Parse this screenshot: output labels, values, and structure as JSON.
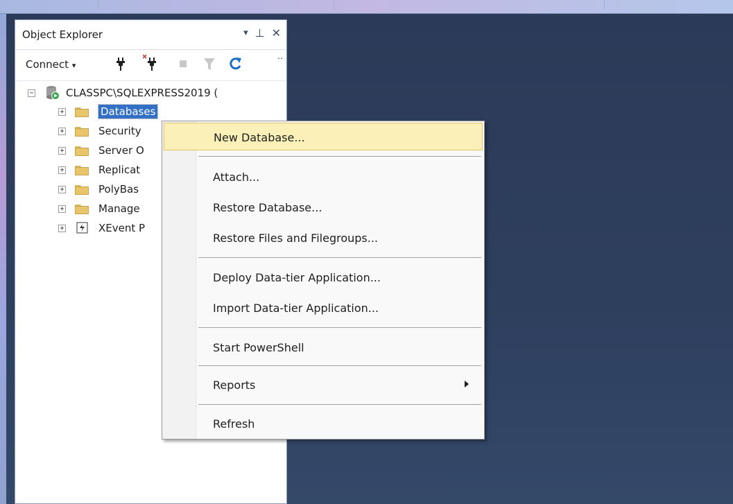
{
  "panel": {
    "title": "Object Explorer",
    "controls": {
      "dropdown": "▾",
      "pin": "⊥",
      "close": "✕"
    }
  },
  "toolbar": {
    "connect_label": "Connect",
    "connect_caret": "▾",
    "overflow": "‥"
  },
  "tree": {
    "server": "CLASSPC\\SQLEXPRESS2019 (",
    "items": [
      {
        "label": "Databases",
        "selected": true
      },
      {
        "label": "Security"
      },
      {
        "label": "Server O"
      },
      {
        "label": "Replicat"
      },
      {
        "label": "PolyBas"
      },
      {
        "label": "Manage"
      },
      {
        "label": "XEvent P",
        "icon": "xevent-icon"
      }
    ]
  },
  "context_menu": {
    "items": [
      {
        "label": "New Database...",
        "highlighted": true
      },
      {
        "label": "Attach..."
      },
      {
        "label": "Restore Database..."
      },
      {
        "label": "Restore Files and Filegroups..."
      },
      {
        "label": "Deploy Data-tier Application..."
      },
      {
        "label": "Import Data-tier Application..."
      },
      {
        "label": "Start PowerShell"
      },
      {
        "label": "Reports",
        "submenu": true
      },
      {
        "label": "Refresh"
      }
    ]
  },
  "colors": {
    "background": "#2e3f5e",
    "selection": "#3170c4",
    "menu_highlight": "#fbf1b8",
    "folder": "#e8c46a"
  }
}
